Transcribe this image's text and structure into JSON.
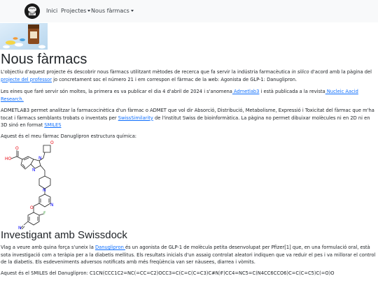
{
  "nav": {
    "logo_icon": "brain-logo-icon",
    "links": [
      {
        "label": "Inici"
      },
      {
        "label": "Projectes"
      },
      {
        "label": "Nous fàrmacs"
      }
    ]
  },
  "hero_image": "pills-and-bottle-image",
  "page": {
    "title": "Nous fàrmacs",
    "p1": {
      "t1": "L'objectiu d'aquest projecte és descobrir nous fàrmacs utilitzant mètodes de recerca que fa servir la indústria farmacèutica ",
      "em": "in silico",
      "t2": " d'acord amb la pàgina del ",
      "link": "projecte del professor",
      "t3": " jo concretament soc el número 21 i em correspon el fàrmac de la web: Agonista de GLP-1: Danuglipron."
    },
    "p2": {
      "t1": "Les eines que faré servir són moltes, la primera es va publicar el dia 4 d'abril de 2024 i s'anomena",
      "link1": " Admetlab3",
      "t2": " i està publicada a la revista",
      "link2": " Nucleic Aacid Research."
    },
    "p3": {
      "t1": "ADMETLAB3 permet analitzar la farmacocinètica d'un fàrmac o ADMET que vol dir Absorció, Distribució, Metabolisme, Expressió i Toxicitat del fàrmac que m'ha tocat i fàrmacs semblants trobats o inventats per ",
      "link1": "SwissSimilarity",
      "t2": " de l'institut Swiss de bioinformàtica. La pàgina no permet dibuixar molècules ni en 2D ni en 3D sinó en format ",
      "link2": "SMILES"
    },
    "p4": "Aquest és el meu fàrmac Danuglipron estructura química:",
    "structure_labels": [
      "O",
      "HO",
      "N",
      "N",
      "O",
      "N",
      "N",
      "O",
      "F",
      "N"
    ],
    "section_title": "Investigant amb Swissdock",
    "p5": {
      "t1": "Vlag a veure amb quina força s'uneix la ",
      "link": "Danuglipron ",
      "t2": "és un agonista de GLP-1 de molècula petita desenvolupat per Pfizer[1] que, en una formulació oral, està sota investigació com a teràpia per a la diabetis mellitus. Els resultats inicials d'un assaig controlat aleatori indiquen que va reduir el pes i va millorar el control de la diabetis. Els esdeveniments adversos notificats amb més freqüència van ser nàusees, diarrea i vòmits."
    },
    "p6": "Aquest és el SMILES del Danuglipron: C1CN(CCC1C2=NC(=CC=C2)OCC3=C(C=C(C=C3)C#N)F)CC4=NC5=C(N4CC6CCO6)C=C(C=C5)C(=O)O"
  },
  "colors": {
    "link": "#0d6efd",
    "navbar": "#f8f9fa",
    "oxygen": "#e8000b",
    "nitrogen": "#0000ff",
    "fluorine": "#339933"
  }
}
